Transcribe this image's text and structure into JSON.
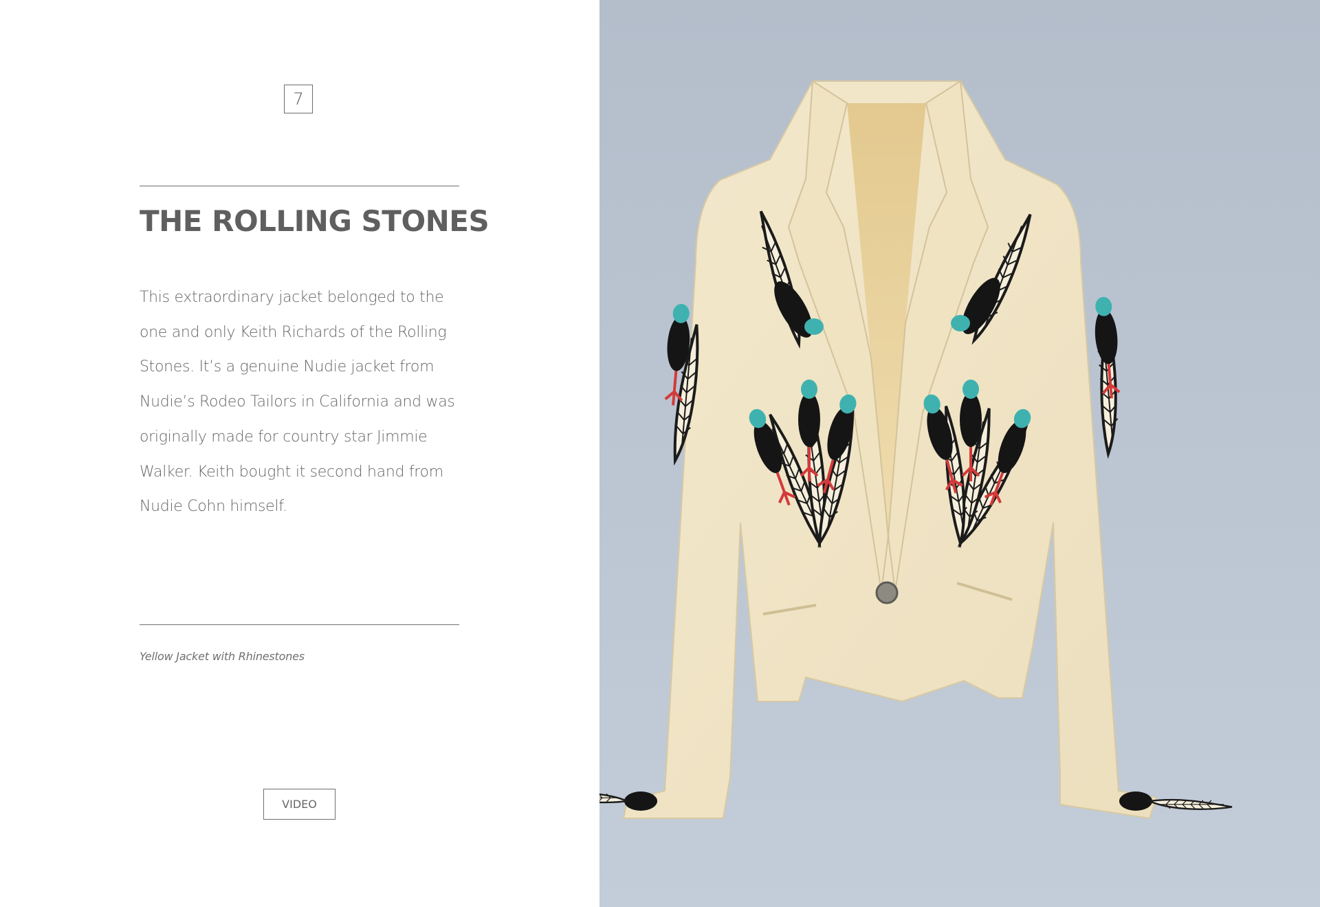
{
  "page": {
    "number": "7"
  },
  "exhibit": {
    "title": "THE ROLLING STONES",
    "description_lines": [
      "This extraordinary jacket belonged to the",
      "one and only Keith Richards of the Rolling",
      "Stones. It’s a genuine Nudie jacket from",
      "Nudie’s Rodeo Tailors in California and was",
      "originally made for country star Jimmie",
      "Walker. Keith bought it second hand from",
      "Nudie Cohn himself."
    ],
    "caption": "Yellow Jacket with Rhinestones",
    "video_label": "VIDEO"
  },
  "photo": {
    "subject": "yellow-jacket-with-rhinestones",
    "background_color": "#b8c2ce",
    "jacket_color": "#f0e4c6"
  },
  "colors": {
    "text": "#666666",
    "title": "#5f5f5f",
    "rule": "#6e6e6e"
  }
}
